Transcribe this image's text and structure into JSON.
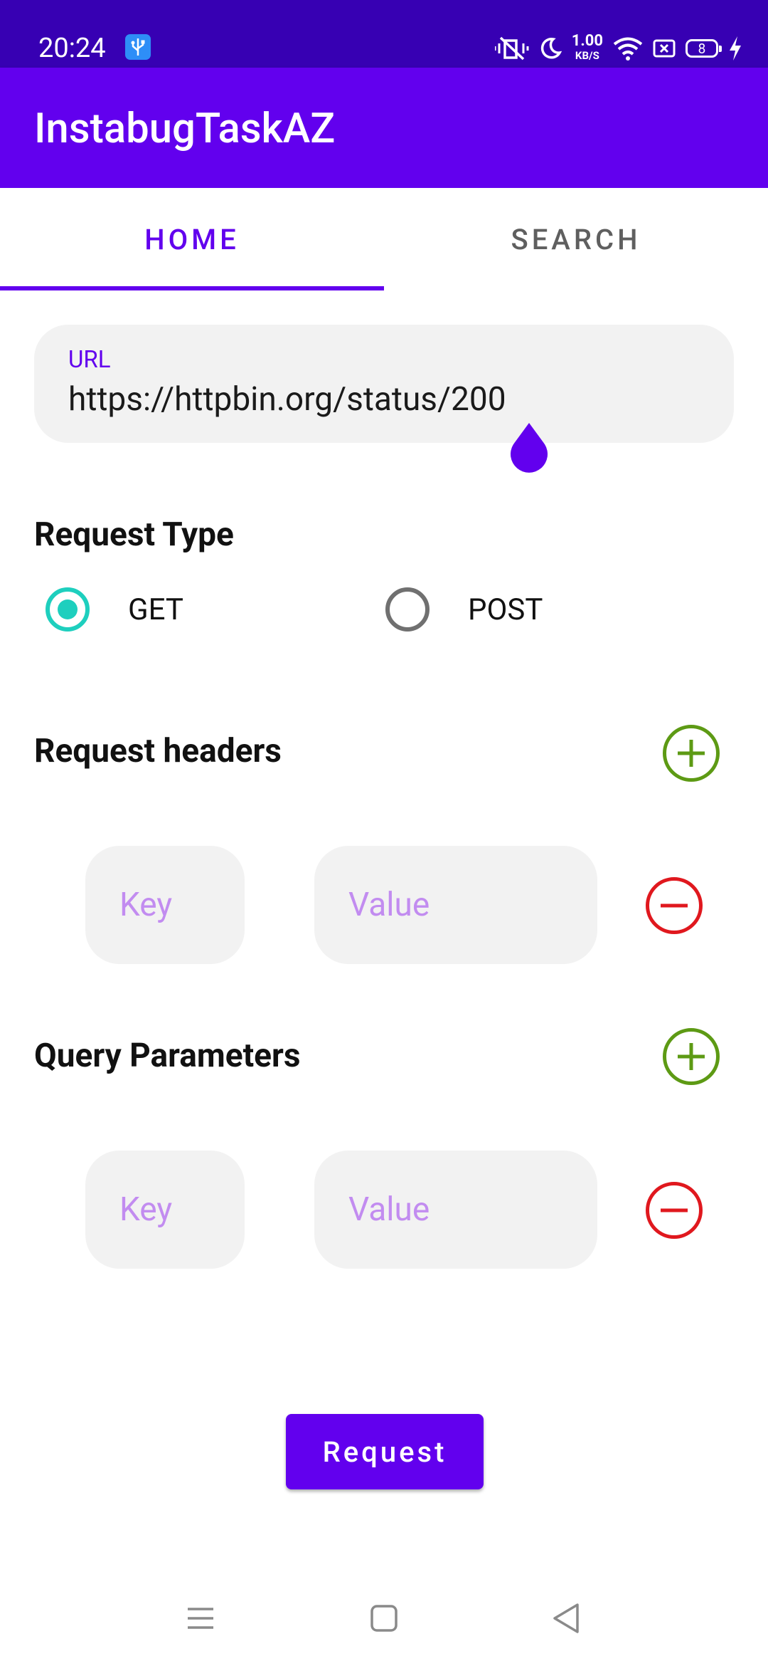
{
  "status_bar": {
    "time": "20:24",
    "net_speed_value": "1.00",
    "net_speed_unit": "KB/S",
    "battery_level": "8",
    "icons": [
      "usb-icon",
      "vibrate-off-icon",
      "moon-icon",
      "wifi-icon",
      "sim-icon",
      "battery-icon",
      "charging-icon"
    ]
  },
  "app_bar": {
    "title": "InstabugTaskAZ"
  },
  "tabs": [
    {
      "label": "HOME",
      "selected": true
    },
    {
      "label": "SEARCH",
      "selected": false
    }
  ],
  "url_field": {
    "label": "URL",
    "value": "https://httpbin.org/status/200"
  },
  "request_type": {
    "title": "Request Type",
    "options": [
      {
        "label": "GET",
        "checked": true
      },
      {
        "label": "POST",
        "checked": false
      }
    ]
  },
  "request_headers": {
    "title": "Request headers",
    "key_placeholder": "Key",
    "value_placeholder": "Value"
  },
  "query_parameters": {
    "title": "Query Parameters",
    "key_placeholder": "Key",
    "value_placeholder": "Value"
  },
  "request_button": {
    "label": "Request"
  },
  "colors": {
    "primary": "#6200ee",
    "status_bar": "#3700b3",
    "radio_accent": "#1ecfbe",
    "add_green": "#5d9a14",
    "remove_red": "#e0181e",
    "hint": "#c28cf0"
  }
}
